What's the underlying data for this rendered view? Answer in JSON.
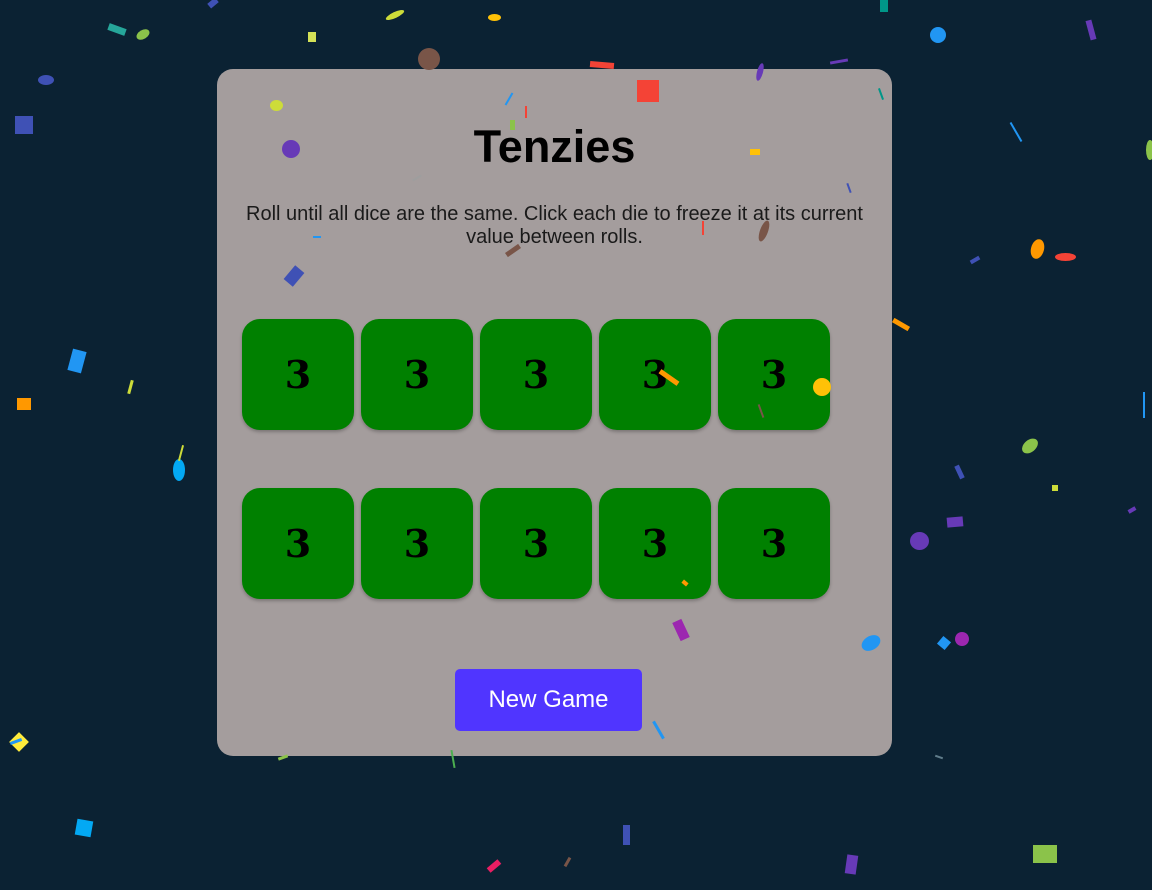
{
  "game": {
    "title": "Tenzies",
    "instructions": "Roll until all dice are the same. Click each die to freeze it at its current value between rolls.",
    "dice": [
      {
        "value": "3",
        "held": true
      },
      {
        "value": "3",
        "held": true
      },
      {
        "value": "3",
        "held": true
      },
      {
        "value": "3",
        "held": true
      },
      {
        "value": "3",
        "held": true
      },
      {
        "value": "3",
        "held": true
      },
      {
        "value": "3",
        "held": true
      },
      {
        "value": "3",
        "held": true
      },
      {
        "value": "3",
        "held": true
      },
      {
        "value": "3",
        "held": true
      }
    ],
    "new_game_label": "New Game"
  },
  "colors": {
    "background": "#0b2233",
    "card": "#a49d9d",
    "held_die": "#008000",
    "button": "#5035ff"
  }
}
